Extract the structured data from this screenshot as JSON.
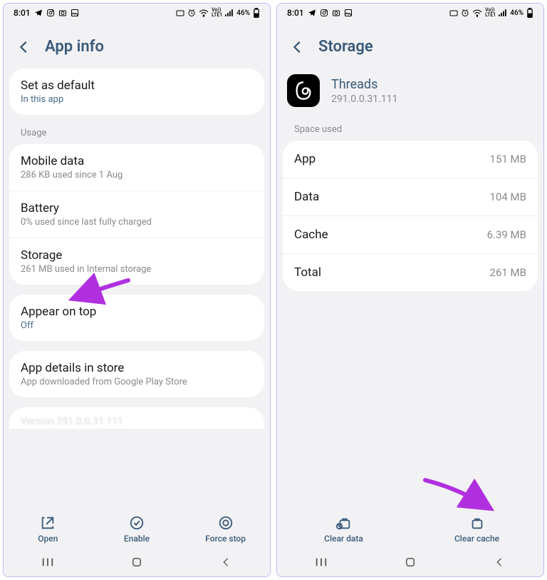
{
  "status": {
    "time": "8:01",
    "battery": "46%"
  },
  "left": {
    "title": "App info",
    "set_default": {
      "title": "Set as default",
      "sub": "In this app"
    },
    "usage_label": "Usage",
    "mobile_data": {
      "title": "Mobile data",
      "sub": "286 KB used since 1 Aug"
    },
    "battery": {
      "title": "Battery",
      "sub": "0% used since last fully charged"
    },
    "storage": {
      "title": "Storage",
      "sub": "261 MB used in Internal storage"
    },
    "appear": {
      "title": "Appear on top",
      "sub": "Off"
    },
    "details": {
      "title": "App details in store",
      "sub": "App downloaded from Google Play Store"
    },
    "version_cut": "Version 291.0.0.31.111",
    "actions": {
      "open": "Open",
      "enable": "Enable",
      "force_stop": "Force stop"
    }
  },
  "right": {
    "title": "Storage",
    "app_name": "Threads",
    "app_version": "291.0.0.31.111",
    "space_label": "Space used",
    "rows": {
      "app": {
        "k": "App",
        "v": "151 MB"
      },
      "data": {
        "k": "Data",
        "v": "104 MB"
      },
      "cache": {
        "k": "Cache",
        "v": "6.39 MB"
      },
      "total": {
        "k": "Total",
        "v": "261 MB"
      }
    },
    "actions": {
      "clear_data": "Clear data",
      "clear_cache": "Clear cache"
    }
  }
}
